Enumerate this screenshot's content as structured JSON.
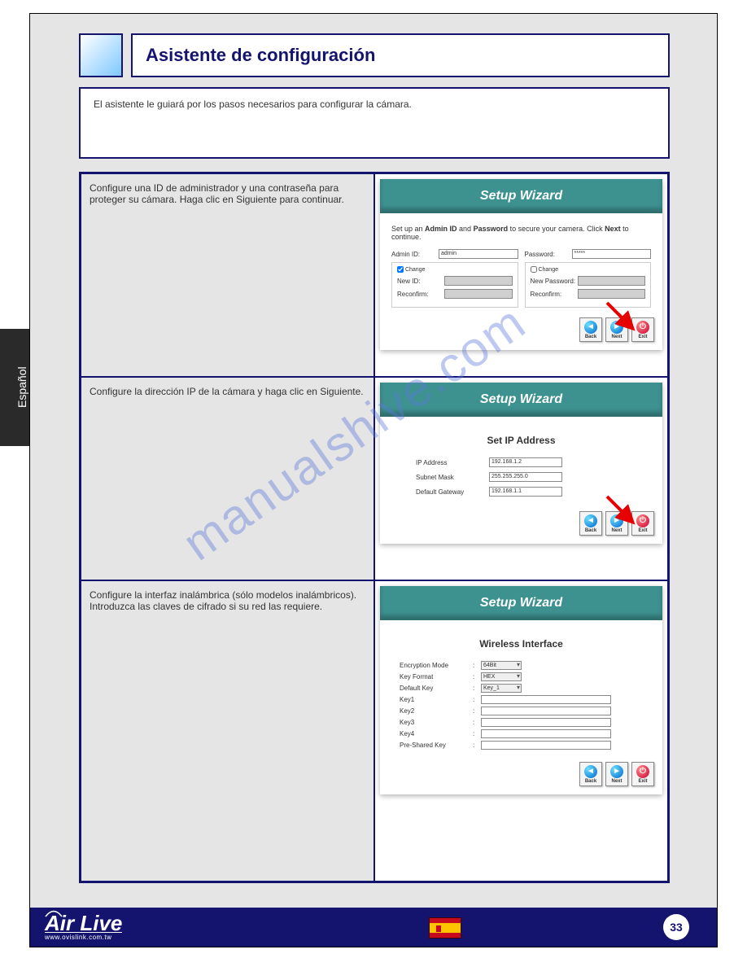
{
  "sidebar_tab": "Español",
  "header": {
    "title": "Asistente de configuración"
  },
  "intro_text": "El asistente le guiará por los pasos necesarios para configurar la cámara.",
  "rows": [
    {
      "left_text": "Configure una ID de administrador y una contraseña para proteger su cámara. Haga clic en Siguiente para continuar.",
      "wizard": {
        "title": "Setup Wizard",
        "desc_prefix": "Set up an ",
        "desc_bold1": "Admin ID",
        "desc_mid": " and ",
        "desc_bold2": "Password",
        "desc_suffix": " to secure your camera. Click ",
        "desc_bold3": "Next",
        "desc_end": " to continue.",
        "left_col": {
          "admin_id_label": "Admin ID:",
          "admin_id_value": "admin",
          "change_label": "Change",
          "new_id_label": "New ID:",
          "reconfirm_label": "Reconfirm:"
        },
        "right_col": {
          "password_label": "Password:",
          "password_value": "*****",
          "change_label": "Change",
          "new_pw_label": "New Password:",
          "reconfirm_label": "Reconfirm:"
        },
        "buttons": {
          "back": "Back",
          "next": "Next",
          "exit": "Exit"
        }
      }
    },
    {
      "left_text": "Configure la dirección IP de la cámara y haga clic en Siguiente.",
      "wizard": {
        "title": "Setup Wizard",
        "section_title": "Set IP Address",
        "fields": {
          "ip_label": "IP Address",
          "ip_value": "192.168.1.2",
          "subnet_label": "Subnet Mask",
          "subnet_value": "255.255.255.0",
          "gateway_label": "Default Gateway",
          "gateway_value": "192.168.1.1"
        },
        "buttons": {
          "back": "Back",
          "next": "Next",
          "exit": "Exit"
        }
      }
    },
    {
      "left_text": "Configure la interfaz inalámbrica (sólo modelos inalámbricos). Introduzca las claves de cifrado si su red las requiere.",
      "wizard": {
        "title": "Setup Wizard",
        "section_title": "Wireless Interface",
        "fields": {
          "enc_label": "Encryption Mode",
          "enc_value": "64Bit",
          "keyf_label": "Key Format",
          "keyf_value": "HEX",
          "defk_label": "Default Key",
          "defk_value": "Key_1",
          "k1_label": "Key1",
          "k2_label": "Key2",
          "k3_label": "Key3",
          "k4_label": "Key4",
          "psk_label": "Pre-Shared Key"
        },
        "buttons": {
          "back": "Back",
          "next": "Next",
          "exit": "Exit"
        }
      }
    }
  ],
  "footer": {
    "logo_main": "Air Live",
    "logo_sub": "www.ovislink.com.tw",
    "page_number": "33"
  },
  "watermark": "manualshive.com"
}
